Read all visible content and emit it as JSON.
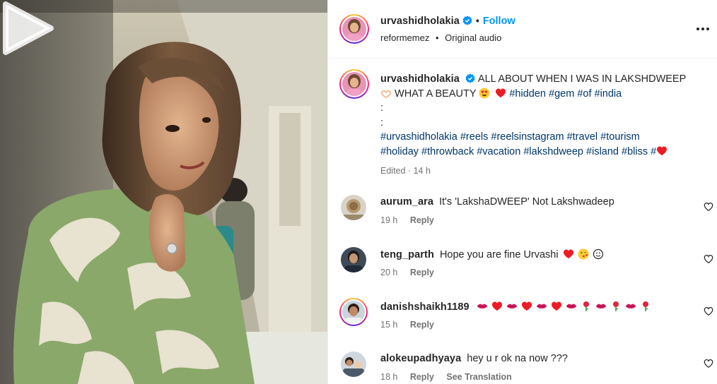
{
  "post": {
    "author": "urvashidholakia",
    "follow_label": "Follow",
    "audio_user": "reformemez",
    "audio_label": "Original audio"
  },
  "caption": {
    "username": "urvashidholakia",
    "line1": "ALL ABOUT WHEN I WAS IN LAKSHDWEEP",
    "line2_text": "WHAT A BEAUTY",
    "line2_tags": [
      "#hidden",
      "#gem",
      "#of",
      "#india"
    ],
    "sep1": ":",
    "sep2": ":",
    "tags_line3": [
      "#urvashidholakia",
      "#reels",
      "#reelsinstagram",
      "#travel",
      "#tourism"
    ],
    "tags_line4": [
      "#holiday",
      "#throwback",
      "#vacation",
      "#lakshdweep",
      "#island",
      "#bliss",
      "#"
    ],
    "edited": "Edited",
    "time": "14 h"
  },
  "comments": [
    {
      "username": "aurum_ara",
      "text": "It's 'LakshaDWEEP' Not Lakshwadeep",
      "time": "19 h",
      "reply": "Reply",
      "translate": ""
    },
    {
      "username": "teng_parth",
      "text": "Hope you are fine Urvashi",
      "time": "20 h",
      "reply": "Reply",
      "translate": ""
    },
    {
      "username": "danishshaikh1189",
      "text": "",
      "time": "15 h",
      "reply": "Reply",
      "translate": ""
    },
    {
      "username": "alokeupadhyaya",
      "text": "hey u r ok na now ???",
      "time": "18 h",
      "reply": "Reply",
      "translate": "See Translation"
    }
  ],
  "icons": {
    "verified": "verified-badge-icon",
    "more": "more-options-icon",
    "like": "heart-outline-icon",
    "play": "play-icon"
  },
  "colors": {
    "link": "#00376b",
    "follow": "#0095f6",
    "muted": "#737373",
    "heart_red": "#ed1c24"
  }
}
